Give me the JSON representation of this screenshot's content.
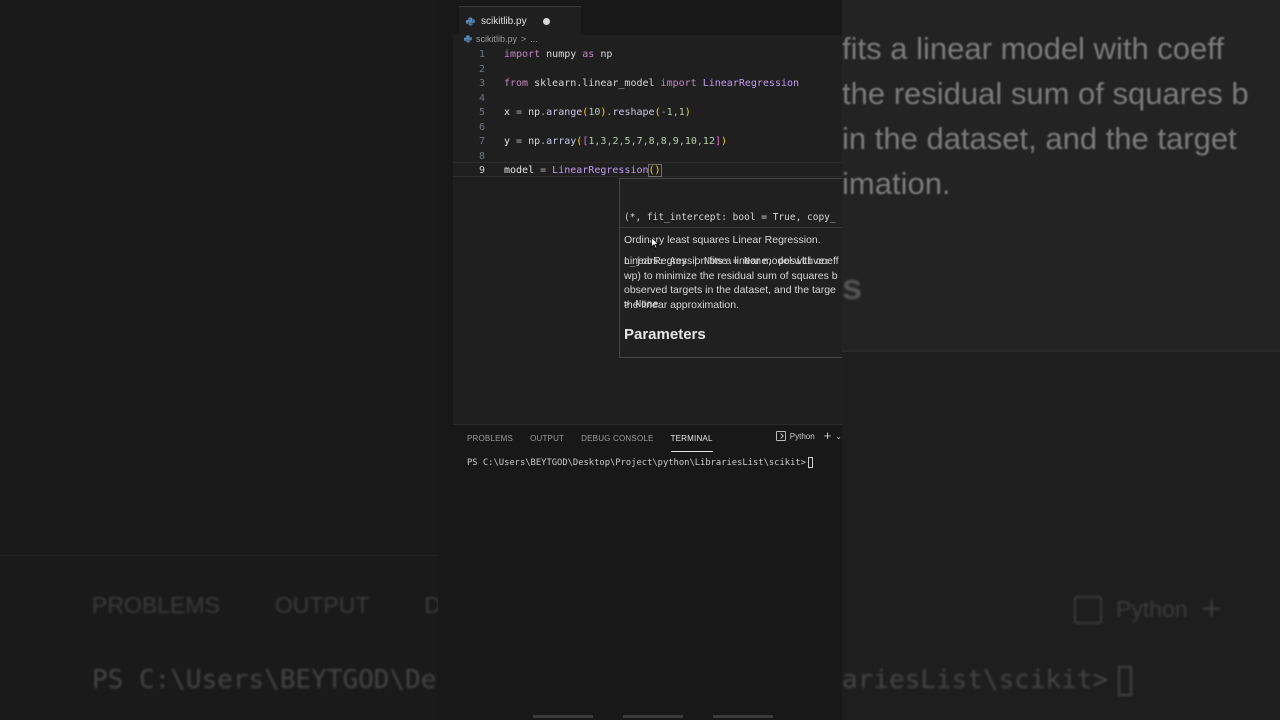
{
  "background": {
    "left_tabs": [
      "PROBLEMS",
      "OUTPUT",
      "DE"
    ],
    "left_prompt": "PS C:\\Users\\BEYTGOD\\De",
    "right_doc_lines": [
      "fits a linear model with coeff",
      "the residual sum of squares b",
      "in the dataset, and the target",
      "imation."
    ],
    "right_s": "s",
    "right_term": "Python",
    "right_prompt": "ariesList\\scikit>"
  },
  "tab": {
    "filename": "scikitlib.py"
  },
  "breadcrumb": {
    "file": "scikitlib.py",
    "sep": ">",
    "more": "..."
  },
  "code": {
    "lines": [
      {
        "n": "1",
        "tokens": [
          [
            "kw",
            "import "
          ],
          [
            "mod",
            "numpy "
          ],
          [
            "kw",
            "as "
          ],
          [
            "mod",
            "np"
          ]
        ]
      },
      {
        "n": "2",
        "tokens": []
      },
      {
        "n": "3",
        "tokens": [
          [
            "kw",
            "from "
          ],
          [
            "mod",
            "sklearn.linear_model "
          ],
          [
            "kw",
            "import "
          ],
          [
            "cls",
            "LinearRegression"
          ]
        ]
      },
      {
        "n": "4",
        "tokens": []
      },
      {
        "n": "5",
        "tokens": [
          [
            "var",
            "x "
          ],
          [
            "op",
            "= "
          ],
          [
            "mod",
            "np"
          ],
          [
            "op",
            "."
          ],
          [
            "fn",
            "arange"
          ],
          [
            "paren",
            "("
          ],
          [
            "num",
            "10"
          ],
          [
            "paren",
            ")"
          ],
          [
            "op",
            "."
          ],
          [
            "fn",
            "reshape"
          ],
          [
            "paren",
            "("
          ],
          [
            "op",
            "-"
          ],
          [
            "num",
            "1"
          ],
          [
            "op",
            ","
          ],
          [
            "num",
            "1"
          ],
          [
            "paren",
            ")"
          ]
        ]
      },
      {
        "n": "6",
        "tokens": []
      },
      {
        "n": "7",
        "tokens": [
          [
            "var",
            "y "
          ],
          [
            "op",
            "= "
          ],
          [
            "mod",
            "np"
          ],
          [
            "op",
            "."
          ],
          [
            "fn",
            "array"
          ],
          [
            "paren",
            "("
          ],
          [
            "bracket",
            "["
          ],
          [
            "num",
            "1"
          ],
          [
            "op",
            ","
          ],
          [
            "num",
            "3"
          ],
          [
            "op",
            ","
          ],
          [
            "num",
            "2"
          ],
          [
            "op",
            ","
          ],
          [
            "num",
            "5"
          ],
          [
            "op",
            ","
          ],
          [
            "num",
            "7"
          ],
          [
            "op",
            ","
          ],
          [
            "num",
            "8"
          ],
          [
            "op",
            ","
          ],
          [
            "num",
            "8"
          ],
          [
            "op",
            ","
          ],
          [
            "num",
            "9"
          ],
          [
            "op",
            ","
          ],
          [
            "num",
            "10"
          ],
          [
            "op",
            ","
          ],
          [
            "num",
            "12"
          ],
          [
            "bracket",
            "]"
          ],
          [
            "paren",
            ")"
          ]
        ]
      },
      {
        "n": "8",
        "tokens": []
      },
      {
        "n": "9",
        "tokens": [
          [
            "var",
            "model "
          ],
          [
            "op",
            "= "
          ],
          [
            "cls",
            "LinearRegression"
          ],
          [
            "paren cursor-paren",
            "()"
          ]
        ]
      }
    ],
    "active_line": "9"
  },
  "hover": {
    "signature": [
      "(*, fit_intercept: bool = True, copy_",
      "n_jobs: Any | None = None, positive:",
      "> None"
    ],
    "summary": "Ordinary least squares Linear Regression.",
    "body": [
      "LinearRegression fits a linear model with coeff",
      "wp) to minimize the residual sum of squares b",
      "observed targets in the dataset, and the targe",
      "the linear approximation."
    ],
    "heading": "Parameters"
  },
  "panel": {
    "tabs": [
      "PROBLEMS",
      "OUTPUT",
      "DEBUG CONSOLE",
      "TERMINAL"
    ],
    "active_tab": "TERMINAL",
    "terminal_label": "Python",
    "plus": "+",
    "chevron": "⌄",
    "prompt": "PS C:\\Users\\BEYTGOD\\Desktop\\Project\\python\\LibrariesList\\scikit>"
  }
}
